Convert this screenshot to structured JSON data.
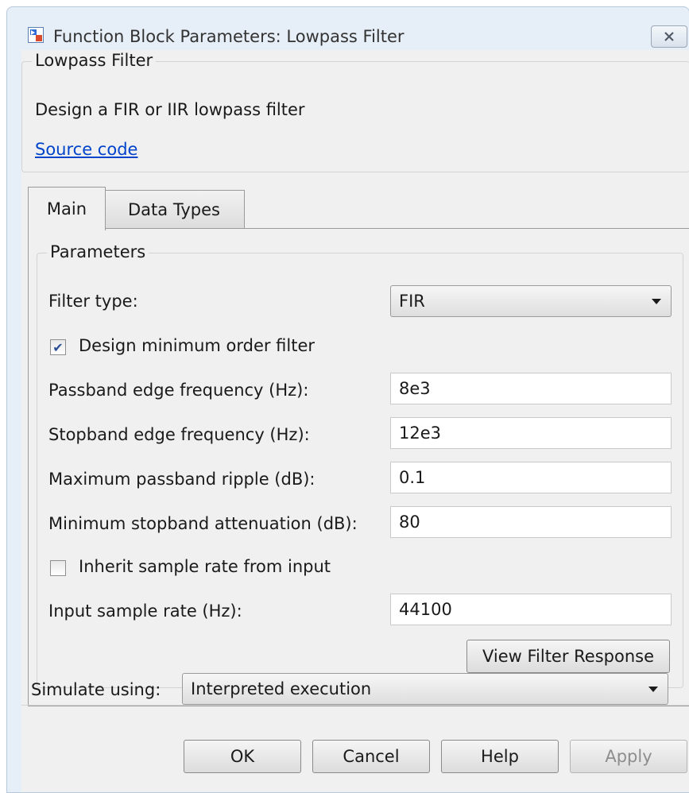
{
  "window": {
    "title": "Function Block Parameters: Lowpass Filter"
  },
  "header": {
    "group_title": "Lowpass Filter",
    "description": "Design a FIR or IIR lowpass filter",
    "source_link": "Source code"
  },
  "tabs": [
    {
      "label": "Main",
      "active": true
    },
    {
      "label": "Data Types",
      "active": false
    }
  ],
  "parameters": {
    "group_title": "Parameters",
    "filter_type_label": "Filter type:",
    "filter_type_value": "FIR",
    "design_min_order_label": "Design minimum order filter",
    "design_min_order_checked": true,
    "passband_edge_label": "Passband edge frequency (Hz):",
    "passband_edge_value": "8e3",
    "stopband_edge_label": "Stopband edge frequency (Hz):",
    "stopband_edge_value": "12e3",
    "max_passband_ripple_label": "Maximum passband ripple (dB):",
    "max_passband_ripple_value": "0.1",
    "min_stopband_atten_label": "Minimum stopband attenuation (dB):",
    "min_stopband_atten_value": "80",
    "inherit_sample_rate_label": "Inherit sample rate from input",
    "inherit_sample_rate_checked": false,
    "input_sample_rate_label": "Input sample rate (Hz):",
    "input_sample_rate_value": "44100",
    "view_response_button": "View Filter Response"
  },
  "simulate": {
    "label": "Simulate using:",
    "value": "Interpreted execution"
  },
  "buttons": {
    "ok": "OK",
    "cancel": "Cancel",
    "help": "Help",
    "apply": "Apply"
  },
  "icons": {
    "app": "simulink-block-icon",
    "close": "close-icon",
    "check": "checkmark-icon",
    "dropdown": "chevron-down-icon"
  },
  "colors": {
    "link": "#0044cc",
    "checkmark": "#2a4f94",
    "window_frame": "#e6eef7"
  }
}
